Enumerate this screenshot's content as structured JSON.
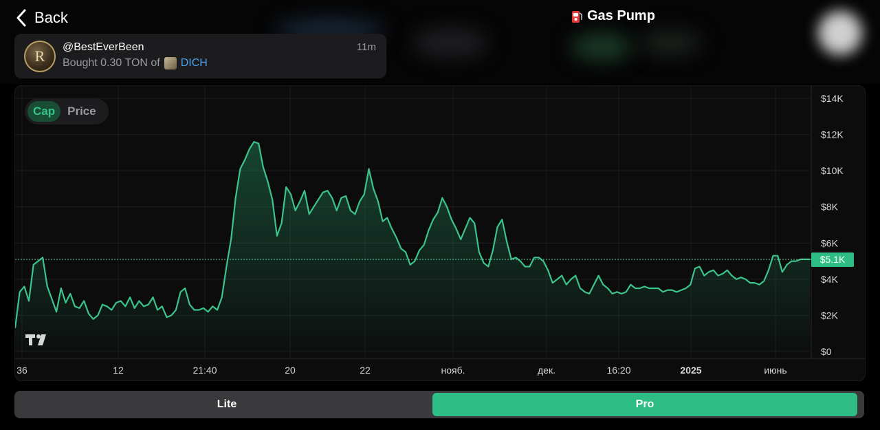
{
  "header": {
    "back_label": "Back",
    "title": "Gas Pump",
    "title_icon": "gas-pump-icon"
  },
  "notification": {
    "user": "@BestEverBeen",
    "time": "11m",
    "action": "Bought 0.30 TON of",
    "token": "DICH",
    "avatar_letter": "R"
  },
  "chart_toggle": {
    "cap_label": "Cap",
    "price_label": "Price",
    "active": "Cap"
  },
  "mode_switch": {
    "lite_label": "Lite",
    "pro_label": "Pro",
    "active": "Pro"
  },
  "colors": {
    "accent": "#2ebd85",
    "link": "#4aa3f0",
    "background": "#000000"
  },
  "chart_data": {
    "type": "area",
    "ylabel": "",
    "ylim": [
      0,
      14000
    ],
    "y_ticks": [
      "$0",
      "$2K",
      "$4K",
      "$6K",
      "$8K",
      "$10K",
      "$12K",
      "$14K"
    ],
    "x_ticks": [
      "36",
      "12",
      "21:40",
      "20",
      "22",
      "нояб.",
      "дек.",
      "16:20",
      "2025",
      "июнь"
    ],
    "current_value_label": "$5.1K",
    "current_value": 5100,
    "series": [
      {
        "values": [
          1300,
          3300,
          3600,
          2800,
          4800,
          5000,
          5200,
          3600,
          2900,
          2200,
          3500,
          2700,
          3200,
          2500,
          2400,
          2800,
          2100,
          1800,
          2000,
          2600,
          2500,
          2300,
          2700,
          2800,
          2500,
          3000,
          2400,
          2800,
          2500,
          2600,
          3000,
          2300,
          2500,
          1900,
          2000,
          2300,
          3300,
          3500,
          2600,
          2300,
          2300,
          2400,
          2200,
          2500,
          2300,
          3000,
          4700,
          6200,
          8500,
          10100,
          10600,
          11200,
          11600,
          11500,
          10200,
          9400,
          8400,
          6400,
          7100,
          9100,
          8700,
          7800,
          8300,
          8900,
          7600,
          8000,
          8400,
          8800,
          8900,
          8500,
          7800,
          8500,
          8600,
          7800,
          7600,
          8300,
          8700,
          10100,
          9000,
          8300,
          7200,
          7400,
          6800,
          6300,
          5700,
          5500,
          4800,
          5000,
          5600,
          5900,
          6700,
          7300,
          7700,
          8500,
          8000,
          7300,
          6800,
          6200,
          6800,
          7400,
          7100,
          5500,
          4900,
          4700,
          5600,
          6900,
          7300,
          6100,
          5100,
          5200,
          5000,
          4700,
          4700,
          5200,
          5200,
          5000,
          4500,
          3800,
          4000,
          4200,
          3700,
          4000,
          4200,
          3500,
          3300,
          3200,
          3700,
          4200,
          3700,
          3500,
          3200,
          3300,
          3200,
          3300,
          3700,
          3500,
          3500,
          3600,
          3500,
          3500,
          3500,
          3300,
          3400,
          3400,
          3300,
          3400,
          3500,
          3700,
          4600,
          4700,
          4200,
          4400,
          4500,
          4200,
          4300,
          4500,
          4200,
          4000,
          4100,
          4000,
          3800,
          3800,
          3700,
          3900,
          4500,
          5300,
          5300,
          4400,
          4800,
          5000,
          5000,
          5100,
          5100,
          5100
        ]
      }
    ],
    "grid": true,
    "legend": "none"
  }
}
